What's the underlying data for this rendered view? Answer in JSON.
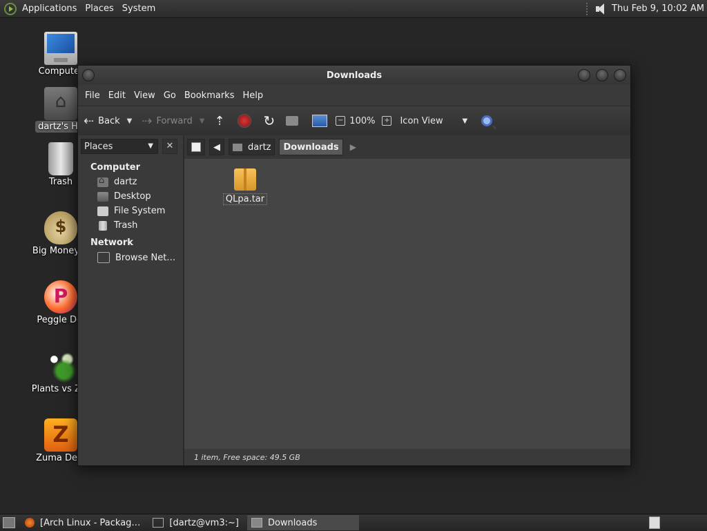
{
  "top_panel": {
    "menus": [
      "Applications",
      "Places",
      "System"
    ],
    "clock": "Thu Feb  9, 10:02 AM",
    "icons": [
      "distro-logo-icon",
      "speaker-icon"
    ]
  },
  "desktop_icons": [
    {
      "label": "Computer",
      "icon": "monitor-icon"
    },
    {
      "label": "dartz's Ho",
      "icon": "folder-home-icon"
    },
    {
      "label": "Trash",
      "icon": "trash-icon"
    },
    {
      "label": "Big Money D",
      "icon": "money-bag-icon"
    },
    {
      "label": "Peggle Del",
      "icon": "peggle-icon"
    },
    {
      "label": "Plants vs Zor",
      "icon": "plants-icon"
    },
    {
      "label": "Zuma Delu",
      "icon": "zuma-icon"
    }
  ],
  "window": {
    "title": "Downloads",
    "menu": [
      "File",
      "Edit",
      "View",
      "Go",
      "Bookmarks",
      "Help"
    ],
    "toolbar": {
      "back": "Back",
      "forward": "Forward",
      "zoom": "100%",
      "view_mode": "Icon View"
    },
    "sidebar": {
      "selector": "Places",
      "sections": [
        {
          "title": "Computer",
          "items": [
            "dartz",
            "Desktop",
            "File System",
            "Trash"
          ]
        },
        {
          "title": "Network",
          "items": [
            "Browse Net…"
          ]
        }
      ]
    },
    "pathbar": [
      "dartz",
      "Downloads"
    ],
    "files": [
      {
        "name": "QLpa.tar",
        "icon": "package-icon"
      }
    ],
    "status": "1 item, Free space: 49.5 GB"
  },
  "taskbar": {
    "tasks": [
      "[Arch Linux - Packag…",
      "[dartz@vm3:~]",
      "Downloads"
    ]
  }
}
